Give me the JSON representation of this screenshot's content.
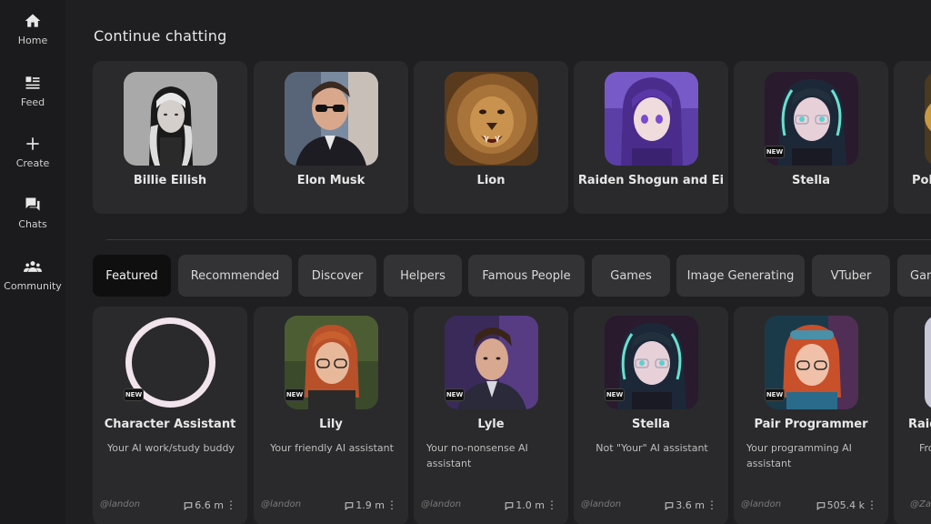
{
  "sidebar": {
    "items": [
      {
        "label": "Home",
        "icon": "home-icon"
      },
      {
        "label": "Feed",
        "icon": "feed-icon"
      },
      {
        "label": "Create",
        "icon": "plus-icon"
      },
      {
        "label": "Chats",
        "icon": "chat-icon"
      },
      {
        "label": "Community",
        "icon": "community-icon"
      }
    ]
  },
  "continue": {
    "title": "Continue chatting",
    "cards": [
      {
        "name": "Billie Eilish"
      },
      {
        "name": "Elon Musk"
      },
      {
        "name": "Lion"
      },
      {
        "name": "Raiden Shogun and Ei"
      },
      {
        "name": "Stella",
        "badge": "NEW"
      },
      {
        "name": "Pok"
      }
    ]
  },
  "tabs": [
    {
      "label": "Featured",
      "active": true
    },
    {
      "label": "Recommended"
    },
    {
      "label": "Discover"
    },
    {
      "label": "Helpers"
    },
    {
      "label": "Famous People"
    },
    {
      "label": "Games"
    },
    {
      "label": "Image Generating"
    },
    {
      "label": "VTuber"
    },
    {
      "label": "Gar"
    }
  ],
  "featured": [
    {
      "name": "Character Assistant",
      "desc": "Your AI work/study buddy",
      "author": "@landon",
      "count": "6.6 m",
      "badge": "NEW"
    },
    {
      "name": "Lily",
      "desc": "Your friendly AI assistant",
      "author": "@landon",
      "count": "1.9 m",
      "badge": "NEW"
    },
    {
      "name": "Lyle",
      "desc": "Your no-nonsense AI assistant",
      "author": "@landon",
      "count": "1.0 m",
      "badge": "NEW"
    },
    {
      "name": "Stella",
      "desc": "Not \"Your\" AI assistant",
      "author": "@landon",
      "count": "3.6 m",
      "badge": "NEW"
    },
    {
      "name": "Pair Programmer",
      "desc": "Your programming AI assistant",
      "author": "@landon",
      "count": "505.4 k",
      "badge": "NEW"
    },
    {
      "name": "Raid",
      "desc": "Fro",
      "author": "@Zap",
      "count": ""
    }
  ],
  "more_glyph": "⋮"
}
